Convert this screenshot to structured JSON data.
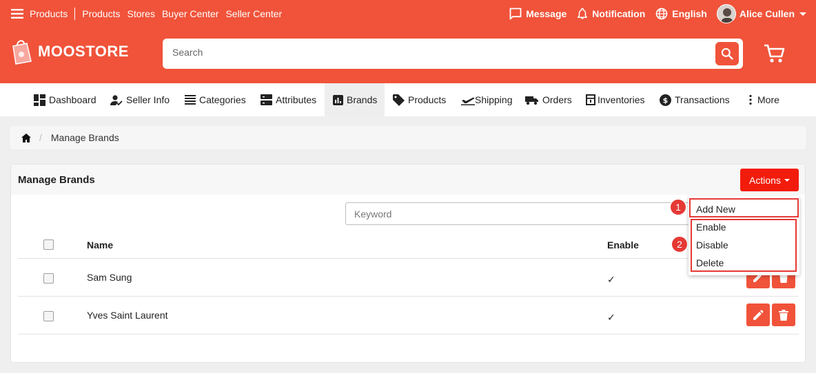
{
  "topbar": {
    "links": [
      "Products",
      "Products",
      "Stores",
      "Buyer Center",
      "Seller Center"
    ],
    "message": "Message",
    "notification": "Notification",
    "language": "English",
    "user": "Alice Cullen"
  },
  "brand": {
    "name": "MOOSTORE"
  },
  "search": {
    "placeholder": "Search"
  },
  "nav": {
    "items": [
      "Dashboard",
      "Seller Info",
      "Categories",
      "Attributes",
      "Brands",
      "Products",
      "Shipping",
      "Orders",
      "Inventories",
      "Transactions",
      "More"
    ],
    "active": "Brands"
  },
  "breadcrumb": {
    "current": "Manage Brands"
  },
  "card": {
    "title": "Manage Brands",
    "actions_label": "Actions",
    "keyword_placeholder": "Keyword"
  },
  "table": {
    "headers": {
      "name": "Name",
      "enable": "Enable"
    },
    "rows": [
      {
        "name": "Sam Sung",
        "enable": "✓"
      },
      {
        "name": "Yves Saint Laurent",
        "enable": "✓"
      }
    ]
  },
  "dropdown": {
    "items": [
      "Add New",
      "Enable",
      "Disable",
      "Delete"
    ],
    "badges": [
      "1",
      "2"
    ]
  },
  "colors": {
    "primary": "#f0533a",
    "action_red": "#f21c0c",
    "highlight": "#e53935"
  }
}
